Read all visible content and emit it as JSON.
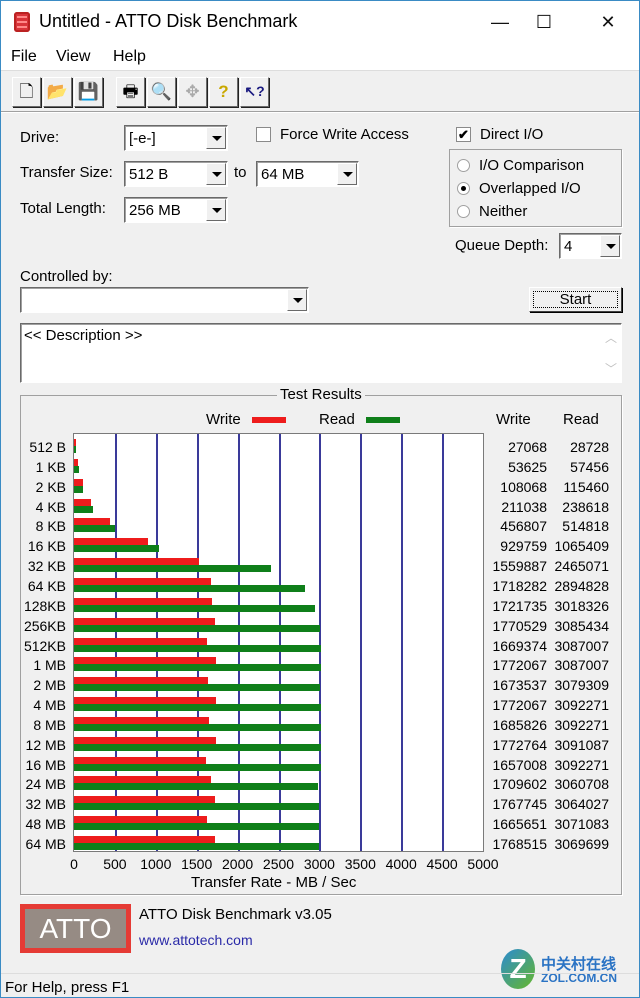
{
  "window": {
    "title": "Untitled - ATTO Disk Benchmark",
    "controls": {
      "minimize": "—",
      "maximize": "☐",
      "close": "✕"
    }
  },
  "menu": [
    {
      "label": "File"
    },
    {
      "label": "View"
    },
    {
      "label": "Help"
    }
  ],
  "toolbar": [
    {
      "name": "new-file-icon",
      "glyph": "🗋"
    },
    {
      "name": "open-folder-icon",
      "glyph": "📂"
    },
    {
      "name": "save-icon",
      "glyph": "💾"
    },
    {
      "name": "print-icon",
      "glyph": "🖶"
    },
    {
      "name": "print-preview-icon",
      "glyph": "🔍"
    },
    {
      "name": "move-icon",
      "glyph": "✥"
    },
    {
      "name": "help-icon",
      "glyph": "?"
    },
    {
      "name": "context-help-icon",
      "glyph": "↖?"
    }
  ],
  "settings": {
    "drive_label": "Drive:",
    "drive_value": "[-e-]",
    "force_write_label": "Force Write Access",
    "force_write_checked": false,
    "direct_io_label": "Direct I/O",
    "direct_io_checked": true,
    "transfer_size_label": "Transfer Size:",
    "transfer_from": "512 B",
    "to_label": "to",
    "transfer_to": "64 MB",
    "total_length_label": "Total Length:",
    "total_length": "256 MB",
    "io_modes": [
      {
        "label": "I/O Comparison",
        "selected": false
      },
      {
        "label": "Overlapped I/O",
        "selected": true
      },
      {
        "label": "Neither",
        "selected": false
      }
    ],
    "queue_depth_label": "Queue Depth:",
    "queue_depth": "4",
    "controlled_by_label": "Controlled by:",
    "controlled_by_value": "",
    "start_label": "Start",
    "description": "<< Description >>"
  },
  "results": {
    "group_title": "Test Results",
    "write_col": "Write",
    "read_col": "Read"
  },
  "chart_data": {
    "type": "bar",
    "orientation": "horizontal",
    "title": "Test Results",
    "xlabel": "Transfer Rate - MB / Sec",
    "ylabel": "",
    "xlim": [
      0,
      5000
    ],
    "xticks": [
      0,
      500,
      1000,
      1500,
      2000,
      2500,
      3000,
      3500,
      4000,
      4500,
      5000
    ],
    "grid": true,
    "legend": "top-center",
    "categories": [
      "512 B",
      "1 KB",
      "2 KB",
      "4 KB",
      "8 KB",
      "16 KB",
      "32 KB",
      "64 KB",
      "128KB",
      "256KB",
      "512KB",
      "1 MB",
      "2 MB",
      "4 MB",
      "8 MB",
      "12 MB",
      "16 MB",
      "24 MB",
      "32 MB",
      "48 MB",
      "64 MB"
    ],
    "series": [
      {
        "name": "Write",
        "color": "#ee1c1c",
        "values_kb_per_sec": [
          27068,
          53625,
          108068,
          211038,
          456807,
          929759,
          1559887,
          1718282,
          1721735,
          1770529,
          1669374,
          1772067,
          1673537,
          1772067,
          1685826,
          1772764,
          1657008,
          1709602,
          1767745,
          1665651,
          1768515
        ]
      },
      {
        "name": "Read",
        "color": "#0f7f1a",
        "values_kb_per_sec": [
          28728,
          57456,
          115460,
          238618,
          514818,
          1065409,
          2465071,
          2894828,
          3018326,
          3085434,
          3087007,
          3087007,
          3079309,
          3092271,
          3092271,
          3091087,
          3092271,
          3060708,
          3064027,
          3071083,
          3069699
        ]
      }
    ]
  },
  "footer": {
    "logo_text": "ATTO",
    "product": "ATTO Disk Benchmark v3.05",
    "link": "www.attotech.com"
  },
  "watermark": {
    "glyph": "Z",
    "cn": "中关村在线",
    "en": "ZOL.COM.CN"
  },
  "status": "For Help, press F1"
}
